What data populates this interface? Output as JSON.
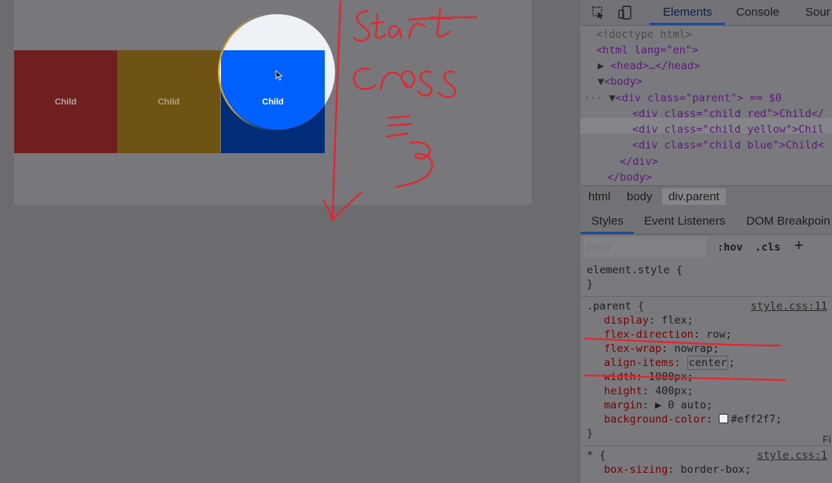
{
  "preview": {
    "children": [
      {
        "label": "Child",
        "color": "red"
      },
      {
        "label": "Child",
        "color": "yellow"
      },
      {
        "label": "Child",
        "color": "blue"
      }
    ]
  },
  "devtools": {
    "tabs": [
      "Elements",
      "Console",
      "Sour"
    ],
    "active_tab": "Elements",
    "dom": [
      "<!doctype html>",
      "<html lang=\"en\">",
      "<head>…</head>",
      "<body>",
      "<div class=\"parent\"> == $0",
      "<div class=\"child red\">Child</",
      "<div class=\"child yellow\">Chil",
      "<div class=\"child blue\">Child<",
      "</div>",
      "</body>"
    ],
    "breadcrumbs": [
      "html",
      "body",
      "div.parent"
    ],
    "styles_tabs": [
      "Styles",
      "Event Listeners",
      "DOM Breakpoin"
    ],
    "filter": {
      "placeholder": "Filter",
      "hov": ":hov",
      "cls": ".cls",
      "plus": "+"
    },
    "element_style": {
      "open": "element.style {",
      "close": "}"
    },
    "parent_rule": {
      "selector": ".parent {",
      "source": "style.css:11",
      "declarations": [
        {
          "prop": "display",
          "value": "flex;"
        },
        {
          "prop": "flex-direction",
          "value": "row;"
        },
        {
          "prop": "flex-wrap",
          "value": "nowrap;"
        },
        {
          "prop": "align-items",
          "value": "center;"
        },
        {
          "prop": "width",
          "value": "1000px;"
        },
        {
          "prop": "height",
          "value": "400px;"
        },
        {
          "prop": "margin",
          "value": "▶ 0 auto;"
        },
        {
          "prop": "background-color",
          "value": "#eff2f7;"
        }
      ],
      "close": "}"
    },
    "universal_rule": {
      "selector": "* {",
      "source": "style.css:1",
      "declarations": [
        {
          "prop": "box-sizing",
          "value": "border-box;"
        }
      ]
    },
    "side_label": "Fi"
  },
  "annotations": {
    "words": [
      "Start",
      "Cross",
      "=",
      "3"
    ],
    "color": "#e8242b"
  },
  "colors": {
    "red_child": "#6e1f1e",
    "yellow_child": "#6e5315",
    "blue_child": "#0060fe",
    "parent_bg": "#eef2f7"
  }
}
